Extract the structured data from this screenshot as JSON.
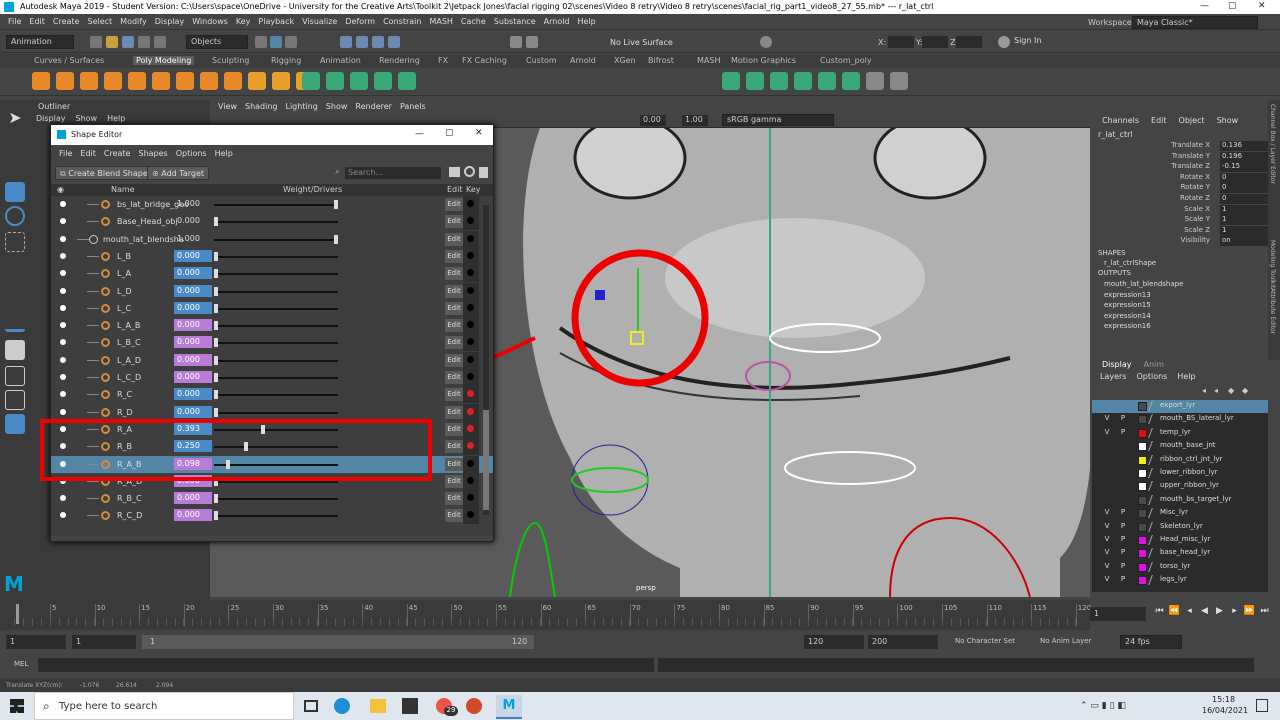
{
  "window": {
    "title": "Autodesk Maya 2019 - Student Version: C:\\Users\\space\\OneDrive - University for the Creative Arts\\Toolkit 2\\Jetpack Jones\\facial rigging 02\\scenes\\Video 8 retry\\Video 8 retry\\scenes\\facial_rig_part1_video8_27_55.mb* --- r_lat_ctrl"
  },
  "menubar": [
    "File",
    "Edit",
    "Create",
    "Select",
    "Modify",
    "Display",
    "Windows",
    "Key",
    "Playback",
    "Visualize",
    "Deform",
    "Constrain",
    "MASH",
    "Cache",
    "Substance",
    "Arnold",
    "Help"
  ],
  "workspace": {
    "label": "Workspace :",
    "value": "Maya Classic*"
  },
  "statusline": {
    "mode": "Animation",
    "objects": "Objects",
    "live_surface": "No Live Surface",
    "x_label": "X:",
    "y_label": "Y:",
    "z_label": "Z:",
    "sign_in": "Sign In"
  },
  "shelf_tabs": [
    "Curves / Surfaces",
    "Poly Modeling",
    "Sculpting",
    "Rigging",
    "Animation",
    "Rendering",
    "FX",
    "FX Caching",
    "Custom",
    "Arnold",
    "XGen",
    "Bifrost",
    "MASH",
    "Motion Graphics",
    "Custom_poly"
  ],
  "shelf_active": "Poly Modeling",
  "outliner": {
    "title": "Outliner",
    "menu": [
      "Display",
      "Show",
      "Help"
    ]
  },
  "viewport": {
    "menu": [
      "View",
      "Shading",
      "Lighting",
      "Show",
      "Renderer",
      "Panels"
    ],
    "exposure": "0.00",
    "gamma": "1.00",
    "colorspace": "sRGB gamma",
    "camera": "persp"
  },
  "shape_editor": {
    "title": "Shape Editor",
    "menu": [
      "File",
      "Edit",
      "Create",
      "Shapes",
      "Options",
      "Help"
    ],
    "create_blend_shape": "Create Blend Shape",
    "add_target": "Add Target",
    "search_placeholder": "Search...",
    "col_name": "Name",
    "col_weight": "Weight/Drivers",
    "col_edit": "Edit",
    "col_key": "Key",
    "edit_label": "Edit",
    "rows": [
      {
        "name": "bs_lat_bridge_geo",
        "value": "1.000",
        "fill": 1.0,
        "style": "plain",
        "key": "#000",
        "indent": 1
      },
      {
        "name": "Base_Head_obj",
        "value": "0.000",
        "fill": 0.0,
        "style": "plain",
        "key": "#000",
        "indent": 1
      },
      {
        "name": "mouth_lat_blendsha",
        "value": "1.000",
        "fill": 1.0,
        "style": "plain",
        "key": "#000",
        "indent": 0
      },
      {
        "name": "L_B",
        "value": "0.000",
        "fill": 0.0,
        "style": "blue",
        "key": "#000",
        "indent": 1
      },
      {
        "name": "L_A",
        "value": "0.000",
        "fill": 0.0,
        "style": "blue",
        "key": "#000",
        "indent": 1
      },
      {
        "name": "L_D",
        "value": "0.000",
        "fill": 0.0,
        "style": "blue",
        "key": "#000",
        "indent": 1
      },
      {
        "name": "L_C",
        "value": "0.000",
        "fill": 0.0,
        "style": "blue",
        "key": "#000",
        "indent": 1
      },
      {
        "name": "L_A_B",
        "value": "0.000",
        "fill": 0.0,
        "style": "purple",
        "key": "#000",
        "indent": 1
      },
      {
        "name": "L_B_C",
        "value": "0.000",
        "fill": 0.0,
        "style": "purple",
        "key": "#000",
        "indent": 1
      },
      {
        "name": "L_A_D",
        "value": "0.000",
        "fill": 0.0,
        "style": "purple",
        "key": "#000",
        "indent": 1
      },
      {
        "name": "L_C_D",
        "value": "0.000",
        "fill": 0.0,
        "style": "purple",
        "key": "#000",
        "indent": 1
      },
      {
        "name": "R_C",
        "value": "0.000",
        "fill": 0.0,
        "style": "blue",
        "key": "#e02020",
        "indent": 1
      },
      {
        "name": "R_D",
        "value": "0.000",
        "fill": 0.0,
        "style": "blue",
        "key": "#e02020",
        "indent": 1
      },
      {
        "name": "R_A",
        "value": "0.393",
        "fill": 0.393,
        "style": "blue",
        "key": "#e02020",
        "indent": 1
      },
      {
        "name": "R_B",
        "value": "0.250",
        "fill": 0.25,
        "style": "blue",
        "key": "#e02020",
        "indent": 1
      },
      {
        "name": "R_A_B",
        "value": "0.098",
        "fill": 0.098,
        "style": "purple",
        "key": "#000",
        "indent": 1,
        "selected": true
      },
      {
        "name": "R_A_D",
        "value": "0.000",
        "fill": 0.0,
        "style": "purple",
        "key": "#000",
        "indent": 1
      },
      {
        "name": "R_B_C",
        "value": "0.000",
        "fill": 0.0,
        "style": "purple",
        "key": "#000",
        "indent": 1
      },
      {
        "name": "R_C_D",
        "value": "0.000",
        "fill": 0.0,
        "style": "purple",
        "key": "#000",
        "indent": 1
      }
    ]
  },
  "channel_box": {
    "tabs": [
      "Channels",
      "Edit",
      "Object",
      "Show"
    ],
    "object": "r_lat_ctrl",
    "attrs": [
      {
        "label": "Translate X",
        "value": "0.136"
      },
      {
        "label": "Translate Y",
        "value": "0.196"
      },
      {
        "label": "Translate Z",
        "value": "-0.15"
      },
      {
        "label": "Rotate X",
        "value": "0"
      },
      {
        "label": "Rotate Y",
        "value": "0"
      },
      {
        "label": "Rotate Z",
        "value": "0"
      },
      {
        "label": "Scale X",
        "value": "1"
      },
      {
        "label": "Scale Y",
        "value": "1"
      },
      {
        "label": "Scale Z",
        "value": "1"
      },
      {
        "label": "Visibility",
        "value": "on"
      }
    ],
    "shapes_header": "SHAPES",
    "shape": "r_lat_ctrlShape",
    "outputs_header": "OUTPUTS",
    "outputs": [
      "mouth_lat_blendshape",
      "expression13",
      "expression15",
      "expression14",
      "expression16"
    ],
    "side_tabs": [
      "Channel Box / Layer Editor",
      "Modeling Toolkit",
      "Attribute Editor"
    ]
  },
  "layer_editor": {
    "tabs": [
      "Display",
      "Anim"
    ],
    "menu": [
      "Layers",
      "Options",
      "Help"
    ],
    "layers": [
      {
        "v": "",
        "p": "",
        "color": "#4a4a4a",
        "name": "export_lyr",
        "selected": true
      },
      {
        "v": "V",
        "p": "P",
        "color": "#4a4a4a",
        "name": "mouth_BS_lateral_lyr"
      },
      {
        "v": "V",
        "p": "P",
        "color": "#e01010",
        "name": "temp_lyr"
      },
      {
        "v": "",
        "p": "",
        "color": "#ffffff",
        "name": "mouth_base_jnt"
      },
      {
        "v": "",
        "p": "",
        "color": "#f0f000",
        "name": "ribbon_ctrl_jnt_lyr"
      },
      {
        "v": "",
        "p": "",
        "color": "#ffffff",
        "name": "lower_ribbon_lyr"
      },
      {
        "v": "",
        "p": "",
        "color": "#ffffff",
        "name": "upper_ribbon_lyr"
      },
      {
        "v": "",
        "p": "",
        "color": "#4a4a4a",
        "name": "mouth_bs_target_lyr"
      },
      {
        "v": "V",
        "p": "P",
        "color": "#4a4a4a",
        "name": "Misc_lyr"
      },
      {
        "v": "V",
        "p": "P",
        "color": "#4a4a4a",
        "name": "Skeleton_lyr"
      },
      {
        "v": "V",
        "p": "P",
        "color": "#e010e0",
        "name": "Head_misc_lyr"
      },
      {
        "v": "V",
        "p": "P",
        "color": "#e010e0",
        "name": "base_head_lyr"
      },
      {
        "v": "V",
        "p": "P",
        "color": "#e010e0",
        "name": "torso_lyr"
      },
      {
        "v": "V",
        "p": "P",
        "color": "#e010e0",
        "name": "legs_lyr"
      }
    ]
  },
  "timeline": {
    "ticks": [
      "5",
      "10",
      "15",
      "20",
      "25",
      "30",
      "35",
      "40",
      "45",
      "50",
      "55",
      "60",
      "65",
      "70",
      "75",
      "80",
      "85",
      "90",
      "95",
      "100",
      "105",
      "110",
      "115",
      "120"
    ],
    "current": "1"
  },
  "range": {
    "start": "1",
    "anim_start": "1",
    "slider_val": "1",
    "slider_end": "120",
    "end": "120",
    "anim_end": "200",
    "character": "No Character Set",
    "anim_layer": "No Anim Layer",
    "fps": "24 fps"
  },
  "mel": {
    "label": "MEL"
  },
  "helpline": {
    "text": "Translate XYZ(cm):",
    "x": "-1.076",
    "y": "26.614",
    "z": "2.094"
  },
  "taskbar": {
    "search": "Type here to search",
    "time": "15:18",
    "date": "16/04/2021",
    "badge": "29"
  }
}
